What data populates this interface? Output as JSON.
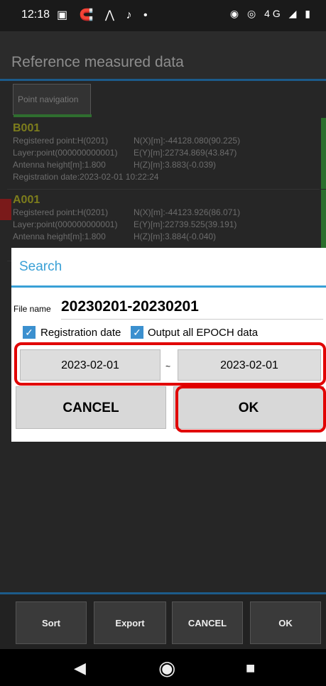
{
  "status": {
    "time": "12:18",
    "left_icons": "▣ 🧲 ⋀ ♪ •",
    "right_icons": "◉ ◎ 4G ◢ ▮"
  },
  "app": {
    "title": "Reference measured data",
    "tab": "Point navigation"
  },
  "records": [
    {
      "name": "B001",
      "registered_point": "Registered point:H(0201)",
      "nx": "N(X)[m]:-44128.080(90.225)",
      "layer": "Layer:point(000000000001)",
      "ey": "E(Y)[m]:22734.869(43.847)",
      "antenna": "Antenna height[m]:1.800",
      "hz": "H(Z)[m]:3.883(-0.039)",
      "registration": "Registration date:2023-02-01 10:22:24"
    },
    {
      "name": "A001",
      "registered_point": "Registered point:H(0201)",
      "nx": "N(X)[m]:-44123.926(86.071)",
      "layer": "Layer:point(000000000001)",
      "ey": "E(Y)[m]:22739.525(39.191)",
      "antenna": "Antenna height[m]:1.800",
      "hz": "H(Z)[m]:3.884(-0.040)",
      "registration": ""
    }
  ],
  "dialog": {
    "title": "Search",
    "file_name_label": "File name",
    "file_name_value": "20230201-20230201",
    "registration_date_label": "Registration date",
    "output_epoch_label": "Output all EPOCH data",
    "date_from": "2023-02-01",
    "tilde": "~",
    "date_to": "2023-02-01",
    "cancel": "CANCEL",
    "ok": "OK"
  },
  "bottom": {
    "sort": "Sort",
    "export": "Export",
    "cancel": "CANCEL",
    "ok": "OK"
  },
  "colors": {
    "accent": "#39a0d6",
    "highlight": "#e10000",
    "point_name": "#7d7d1c"
  }
}
